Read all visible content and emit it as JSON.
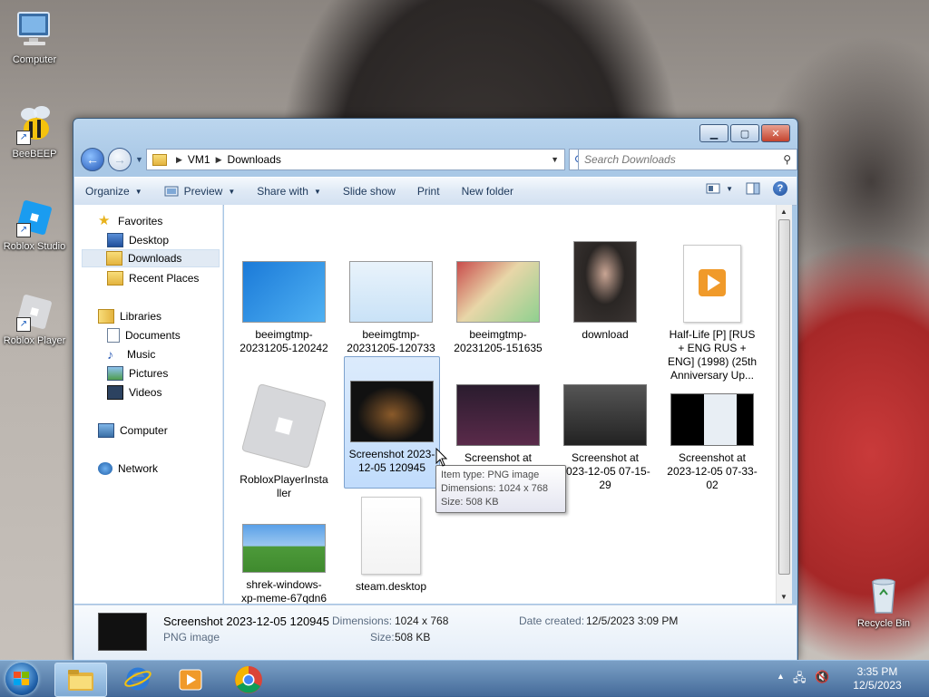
{
  "desktop": {
    "icons": [
      {
        "label": "Computer"
      },
      {
        "label": "BeeBEEP"
      },
      {
        "label": "Roblox Studio"
      },
      {
        "label": "Roblox Player"
      },
      {
        "label": "Recycle Bin"
      }
    ]
  },
  "window": {
    "address": {
      "segments": [
        "VM1",
        "Downloads"
      ]
    },
    "search": {
      "placeholder": "Search Downloads"
    },
    "toolbar": {
      "organize": "Organize",
      "preview": "Preview",
      "share_with": "Share with",
      "slide_show": "Slide show",
      "print": "Print",
      "new_folder": "New folder"
    },
    "nav_pane": {
      "favorites": "Favorites",
      "desktop": "Desktop",
      "downloads": "Downloads",
      "recent_places": "Recent Places",
      "libraries": "Libraries",
      "documents": "Documents",
      "music": "Music",
      "pictures": "Pictures",
      "videos": "Videos",
      "computer": "Computer",
      "network": "Network"
    },
    "files": [
      {
        "name": "beeimgtmp-20231205-120242"
      },
      {
        "name": "beeimgtmp-20231205-120733"
      },
      {
        "name": "beeimgtmp-20231205-151635"
      },
      {
        "name": "download"
      },
      {
        "name": "Half-Life [P] [RUS + ENG RUS + ENG] (1998) (25th Anniversary Up..."
      },
      {
        "name": "RobloxPlayerInstaller"
      },
      {
        "name": "Screenshot 2023-12-05 120945"
      },
      {
        "name": "Screenshot at 2023-12-05"
      },
      {
        "name": "Screenshot at 2023-12-05 07-15-29"
      },
      {
        "name": "Screenshot at 2023-12-05 07-33-02"
      },
      {
        "name": "shrek-windows-xp-meme-67qdn6"
      },
      {
        "name": "steam.desktop"
      }
    ],
    "tooltip": {
      "type": "Item type: PNG image",
      "dimensions": "Dimensions: 1024 x 768",
      "size": "Size: 508 KB"
    },
    "details": {
      "name": "Screenshot 2023-12-05 120945",
      "type": "PNG image",
      "dimensions_label": "Dimensions:",
      "dimensions_value": "1024 x 768",
      "size_label": "Size:",
      "size_value": "508 KB",
      "date_label": "Date created:",
      "date_value": "12/5/2023 3:09 PM"
    }
  },
  "taskbar": {
    "time": "3:35 PM",
    "date": "12/5/2023"
  }
}
